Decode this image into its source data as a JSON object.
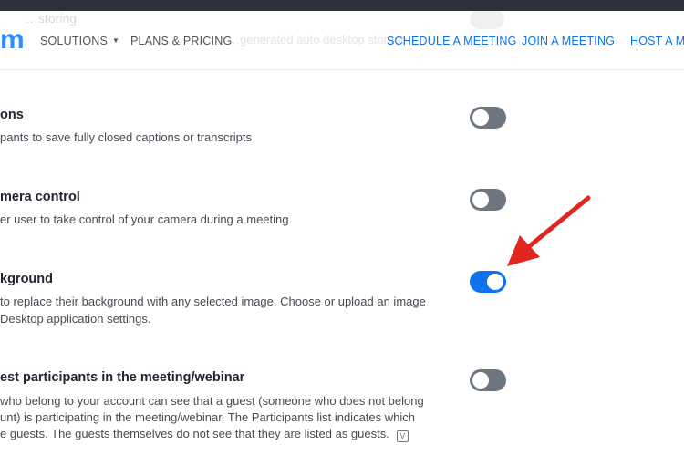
{
  "nav": {
    "logo": "m",
    "ghost_text": "…storing",
    "ghost_text2": "…generated auto desktop storage",
    "items": [
      {
        "label": "SOLUTIONS"
      },
      {
        "label": "PLANS & PRICING"
      }
    ],
    "right_items": [
      {
        "label": "SCHEDULE A MEETING"
      },
      {
        "label": "JOIN A MEETING"
      },
      {
        "label": "HOST A ME"
      }
    ]
  },
  "settings": [
    {
      "title": "ons",
      "desc": [
        "pants to save fully closed captions or transcripts"
      ],
      "enabled": false
    },
    {
      "title": "mera control",
      "desc": [
        "er user to take control of your camera during a meeting"
      ],
      "enabled": false
    },
    {
      "title": "kground",
      "desc": [
        "to replace their background with any selected image. Choose or upload an image",
        "Desktop application settings."
      ],
      "enabled": true
    },
    {
      "title": "est participants in the meeting/webinar",
      "desc": [
        "who belong to your account can see that a guest (someone who does not belong",
        "unt) is participating in the meeting/webinar. The Participants list indicates which",
        "e guests. The guests themselves do not see that they are listed as guests."
      ],
      "enabled": false
    }
  ],
  "colors": {
    "accent": "#0e72ed",
    "toggle_off": "#6e7680",
    "arrow": "#e0261f"
  }
}
